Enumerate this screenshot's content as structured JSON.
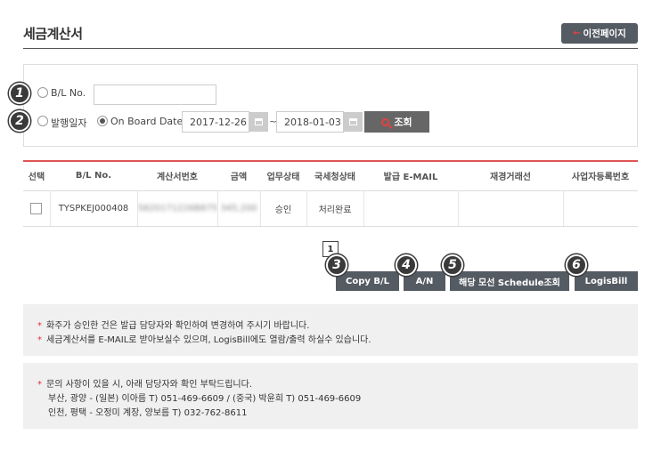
{
  "header": {
    "title": "세금계산서",
    "prev_label": "이전페이지"
  },
  "search": {
    "bl_label": "B/L No.",
    "bl_value": "",
    "issue_date_label": "발행일자",
    "onboard_label": "On Board Date",
    "date_from": "2017-12-26",
    "date_to": "2018-01-03",
    "tilde": "~",
    "search_label": "조회"
  },
  "badges": [
    "1",
    "2",
    "3",
    "4",
    "5",
    "6"
  ],
  "table": {
    "columns": [
      "선택",
      "B/L No.",
      "계산서번호",
      "금액",
      "업무상태",
      "국세청상태",
      "발급 E-MAIL",
      "재경거래선",
      "사업자등록번호"
    ],
    "rows": [
      {
        "bl_no": "TYSPKEJ000408",
        "invoice_no": "5820171226B875",
        "amount": "345,200",
        "work_status": "승인",
        "nts_status": "처리완료",
        "email": "",
        "finance_partner": "",
        "biz_no": ""
      }
    ]
  },
  "pagination": {
    "current": "1"
  },
  "actions": {
    "copy_bl": "Copy B/L",
    "an": "A/N",
    "schedule": "해당 모선 Schedule조회",
    "logisbill": "LogisBill"
  },
  "notice1": {
    "line1": "화주가 승인한 건은 발급 담당자와 확인하여 변경하여 주시기 바랍니다.",
    "line2": "세금계산서를 E-MAIL로 받아보실수 있으며, LogisBill에도 열람/출력 하실수 있습니다."
  },
  "notice2": {
    "line1": "문의 사항이 있을 시, 아래 담당자와 확인 부탁드립니다.",
    "line2": "부산, 광양 - (일본) 이아름 T) 051-469-6609 / (중국) 박윤희 T) 051-469-6609",
    "line3": "인천, 평택 - 오정미 계장, 양보름 T) 032-762-8611"
  },
  "colors": {
    "accent_red": "#e05555",
    "button_dark": "#555b63",
    "badge": "#3a3a3a"
  }
}
